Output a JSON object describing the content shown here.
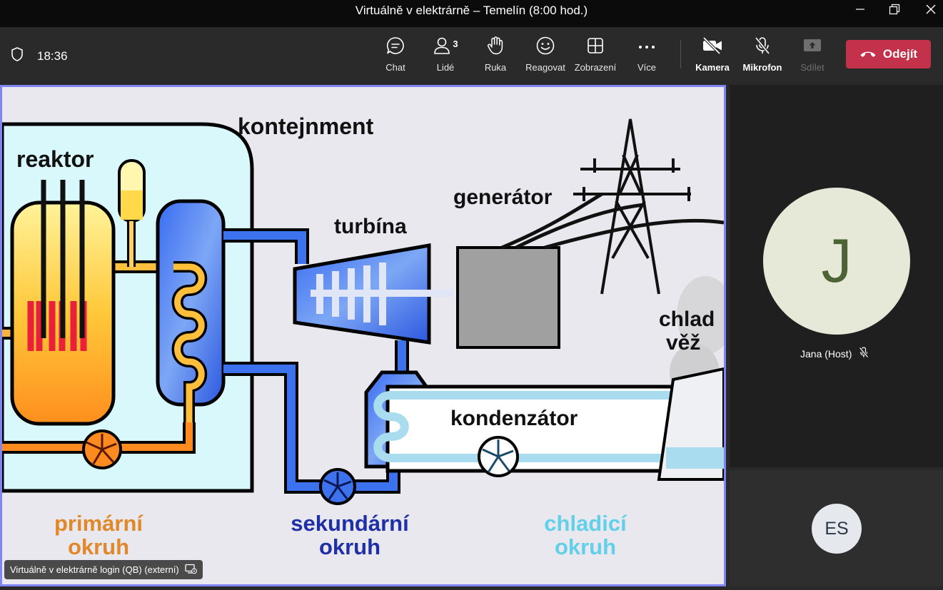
{
  "window": {
    "title": "Virtuálně v elektrárně – Temelín (8:00 hod.)"
  },
  "toolbar": {
    "clock": "18:36",
    "people_count": "3",
    "buttons": {
      "chat": "Chat",
      "people": "Lidé",
      "hand": "Ruka",
      "react": "Reagovat",
      "view": "Zobrazení",
      "more": "Více",
      "camera": "Kamera",
      "mic": "Mikrofon",
      "share": "Sdílet"
    },
    "leave": "Odejít"
  },
  "stage": {
    "presenter_label": "Virtuálně v elektrárně login (QB) (externí)",
    "diagram": {
      "kontejnment": "kontejnment",
      "reaktor": "reaktor",
      "generator": "generátor",
      "turbina": "turbína",
      "chlad_1": "chlad",
      "chlad_2": "věž",
      "kondenzator": "kondenzátor",
      "primarni_1": "primární",
      "primarni_2": "okruh",
      "sekundarni_1": "sekundární",
      "sekundarni_2": "okruh",
      "chladici_1": "chladicí",
      "chladici_2": "okruh"
    }
  },
  "participants": {
    "main": {
      "initial": "J",
      "name": "Jana (Host)",
      "muted": true
    },
    "self": {
      "initials": "ES"
    }
  },
  "colors": {
    "accent": "#7f85f5",
    "leave": "#c4314b",
    "avatar_j_bg": "#e6e9d8",
    "avatar_j_fg": "#4b6335",
    "avatar_es_bg": "#e5e8ec"
  }
}
